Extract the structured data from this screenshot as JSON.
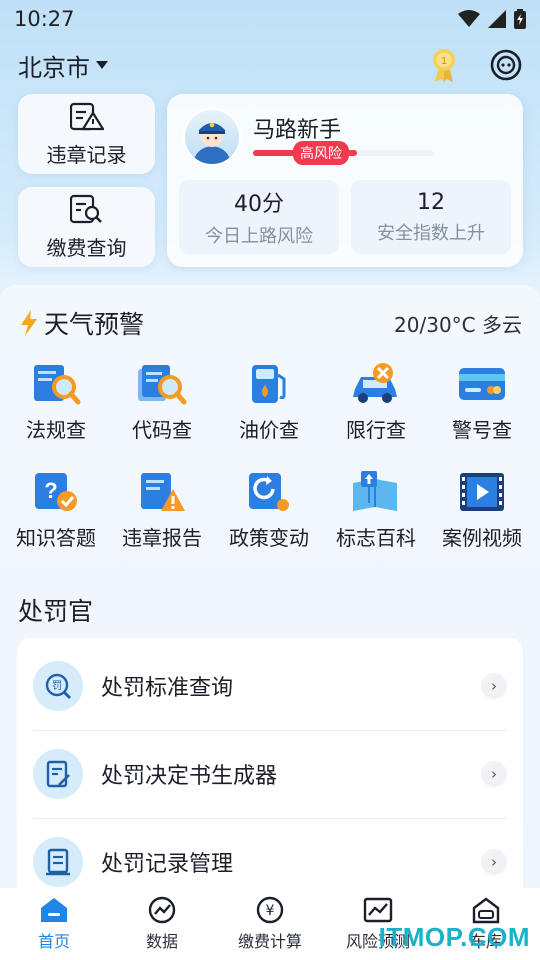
{
  "status": {
    "time": "10:27"
  },
  "header": {
    "city": "北京市"
  },
  "quick_cards": [
    {
      "label": "违章记录",
      "icon": "violation-record-icon"
    },
    {
      "label": "缴费查询",
      "icon": "payment-query-icon"
    }
  ],
  "profile": {
    "name": "马路新手",
    "risk_label": "高风险",
    "risk_level": 0.58,
    "stats": [
      {
        "value": "40分",
        "label": "今日上路风险"
      },
      {
        "value": "12",
        "label": "安全指数上升"
      }
    ]
  },
  "weather": {
    "title": "天气预警",
    "value": "20/30°C 多云"
  },
  "tools": [
    {
      "label": "法规查",
      "icon": "regulation-search-icon"
    },
    {
      "label": "代码查",
      "icon": "code-search-icon"
    },
    {
      "label": "油价查",
      "icon": "fuel-price-icon"
    },
    {
      "label": "限行查",
      "icon": "traffic-restriction-icon"
    },
    {
      "label": "警号查",
      "icon": "police-id-icon"
    },
    {
      "label": "知识答题",
      "icon": "quiz-icon"
    },
    {
      "label": "违章报告",
      "icon": "violation-report-icon"
    },
    {
      "label": "政策变动",
      "icon": "policy-change-icon"
    },
    {
      "label": "标志百科",
      "icon": "sign-encyclopedia-icon"
    },
    {
      "label": "案例视频",
      "icon": "case-video-icon"
    }
  ],
  "section": {
    "title": "处罚官"
  },
  "list": [
    {
      "label": "处罚标准查询",
      "icon": "penalty-standard-icon"
    },
    {
      "label": "处罚决定书生成器",
      "icon": "penalty-document-icon"
    },
    {
      "label": "处罚记录管理",
      "icon": "penalty-records-icon"
    }
  ],
  "tabs": [
    {
      "label": "首页",
      "icon": "home-icon",
      "active": true
    },
    {
      "label": "数据",
      "icon": "data-icon"
    },
    {
      "label": "缴费计算",
      "icon": "fee-calc-icon"
    },
    {
      "label": "风险预测",
      "icon": "risk-forecast-icon"
    },
    {
      "label": "车库",
      "icon": "garage-icon"
    }
  ],
  "watermark": "ITMOP.COM",
  "colors": {
    "accent": "#1e86e6",
    "risk": "#ef3b4d",
    "watermark": "#19b3c9"
  }
}
